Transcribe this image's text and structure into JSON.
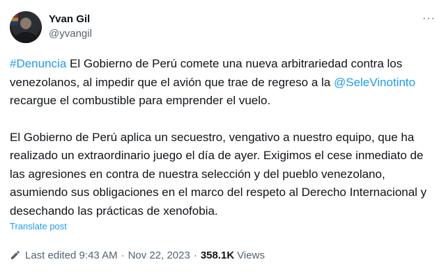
{
  "author": {
    "name": "Yvan Gil",
    "handle": "@yvangil"
  },
  "menu": {
    "more_label": "···"
  },
  "post": {
    "p1": {
      "hashtag": "#Denuncia",
      "text1": " El Gobierno de Perú comete una nueva arbitrariedad contra los venezolanos, al impedir que el avión que trae de regreso a la ",
      "mention": "@SeleVinotinto",
      "text2": " recargue el combustible para emprender el vuelo."
    },
    "p2": "El Gobierno de Perú aplica un secuestro, vengativo a nuestro equipo, que ha realizado un extraordinario juego el día de ayer. Exigimos el cese inmediato de las agresiones en contra de nuestra selección y del pueblo venezolano, asumiendo sus obligaciones en el marco del respeto al Derecho Internacional y desechando las prácticas de xenofobia."
  },
  "translate_label": "Translate post",
  "meta": {
    "edited": "Last edited 9:43 AM",
    "separator": "·",
    "date": "Nov 22, 2023",
    "views_count": "358.1K",
    "views_label": "Views"
  },
  "icons": {
    "edit": "pencil-icon",
    "more": "more-horizontal-icon"
  },
  "colors": {
    "link": "#1d9bf0",
    "text": "#0f1419",
    "muted": "#536471"
  }
}
